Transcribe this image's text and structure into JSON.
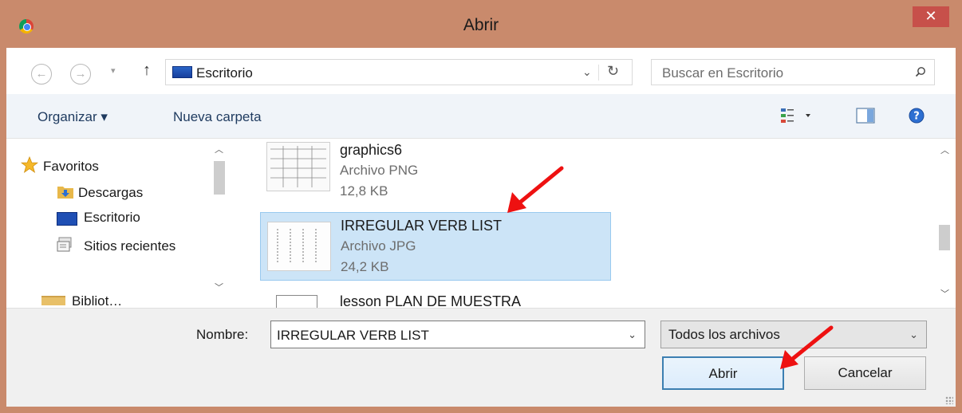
{
  "window": {
    "title": "Abrir",
    "close_glyph": "✕"
  },
  "nav": {
    "back_glyph": "←",
    "forward_glyph": "→",
    "recent_glyph": "▾",
    "up_glyph": "↑",
    "address": "Escritorio",
    "address_chevron": "⌄",
    "refresh_glyph": "↻",
    "search_placeholder": "Buscar en Escritorio"
  },
  "toolbar": {
    "organize": "Organizar ▾",
    "new_folder": "Nueva carpeta"
  },
  "sidebar": {
    "items": [
      {
        "label": "Favoritos",
        "icon": "star-icon"
      },
      {
        "label": "Descargas",
        "icon": "downloads-folder-icon"
      },
      {
        "label": "Escritorio",
        "icon": "desktop-icon"
      },
      {
        "label": "Sitios recientes",
        "icon": "recent-places-icon"
      },
      {
        "label": "Bibliot…",
        "icon": "libraries-icon"
      }
    ]
  },
  "files": [
    {
      "name": "graphics6",
      "type": "Archivo PNG",
      "size": "12,8 KB",
      "selected": false
    },
    {
      "name": "IRREGULAR VERB LIST",
      "type": "Archivo JPG",
      "size": "24,2 KB",
      "selected": true
    },
    {
      "name": "lesson PLAN DE MUESTRA",
      "type": "",
      "size": "",
      "selected": false
    }
  ],
  "footer": {
    "name_label": "Nombre:",
    "name_value": "IRREGULAR VERB LIST",
    "filter_value": "Todos los archivos",
    "open_button": "Abrir",
    "cancel_button": "Cancelar"
  },
  "colors": {
    "frame": "#c98a6c",
    "close": "#c7504a",
    "selection": "#cce4f7",
    "annotation_arrow": "#ee1111"
  }
}
